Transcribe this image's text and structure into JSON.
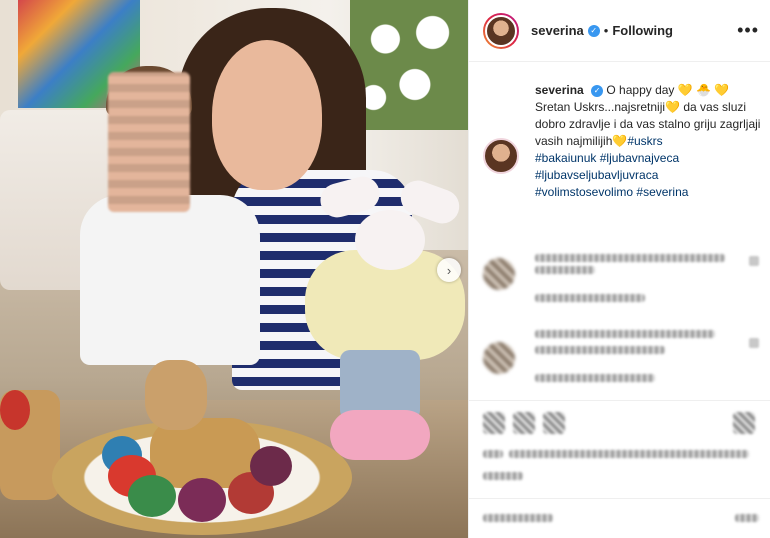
{
  "post": {
    "username": "severina",
    "follow_state": "Following",
    "more_label": "•••",
    "dot": "•",
    "verified_mark": "✓",
    "next_arrow": "›"
  },
  "caption": {
    "username": "severina",
    "line1": "O happy day",
    "line1_emoji": "💛 🐣 💛",
    "line2a": "Sretan Uskrs...najsretniji",
    "line2_emoji": "💛",
    "line2b": " da vas sluzi dobro zdravlje i da vas stalno griju zagrljaji vasih najmilijih",
    "line3_emoji": "💛",
    "hashtags": [
      "#uskrs",
      "#bakaiunuk",
      "#ljubavnajveca",
      "#ljubavseljubavljuvraca",
      "#volimstosevolimo",
      "#severina"
    ]
  },
  "colors": {
    "text": "#262626",
    "hashtag": "#003569",
    "verified": "#3897f0",
    "border": "#efefef"
  },
  "icons": [
    "more-icon",
    "verified-icon",
    "next-arrow-icon",
    "like-icon",
    "comment-icon",
    "share-icon",
    "save-icon"
  ]
}
